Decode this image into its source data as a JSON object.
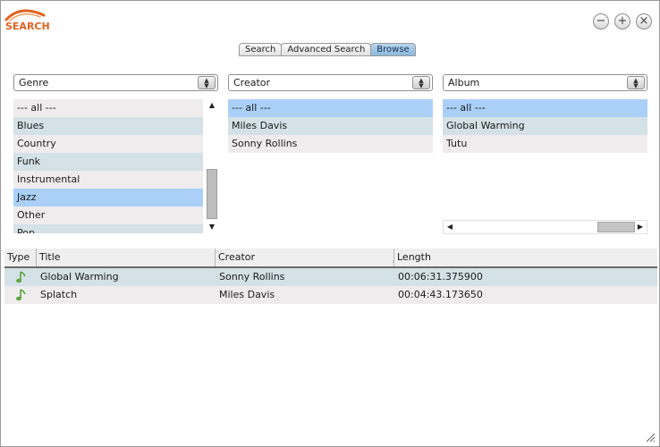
{
  "app": {
    "logo_text": "SEARCH"
  },
  "window_controls": {
    "minimize": "−",
    "maximize": "+",
    "close": "×"
  },
  "tabs": [
    {
      "label": "Search",
      "active": false
    },
    {
      "label": "Advanced Search",
      "active": false
    },
    {
      "label": "Browse",
      "active": true
    }
  ],
  "filters": {
    "genre": {
      "label": "Genre",
      "items": [
        "--- all ---",
        "Blues",
        "Country",
        "Funk",
        "Instrumental",
        "Jazz",
        "Other",
        "Pop"
      ],
      "selected": "Jazz"
    },
    "creator": {
      "label": "Creator",
      "items": [
        "--- all ---",
        "Miles Davis",
        "Sonny Rollins"
      ],
      "selected": "--- all ---"
    },
    "album": {
      "label": "Album",
      "items": [
        "--- all ---",
        "Global Warming",
        "Tutu"
      ],
      "selected": "--- all ---"
    }
  },
  "results": {
    "columns": [
      "Type",
      "Title",
      "Creator",
      "Length"
    ],
    "rows": [
      {
        "type_icon": "music-note-icon",
        "title": "Global Warming",
        "creator": "Sonny Rollins",
        "length": "00:06:31.375900"
      },
      {
        "type_icon": "music-note-icon",
        "title": "Splatch",
        "creator": "Miles Davis",
        "length": "00:04:43.173650"
      }
    ]
  },
  "colors": {
    "accent": "#e0621e",
    "selection": "#aad0f8",
    "row_alt": "#d4e1e7",
    "row_base": "#efecee",
    "note_icon": "#5aa53a"
  }
}
